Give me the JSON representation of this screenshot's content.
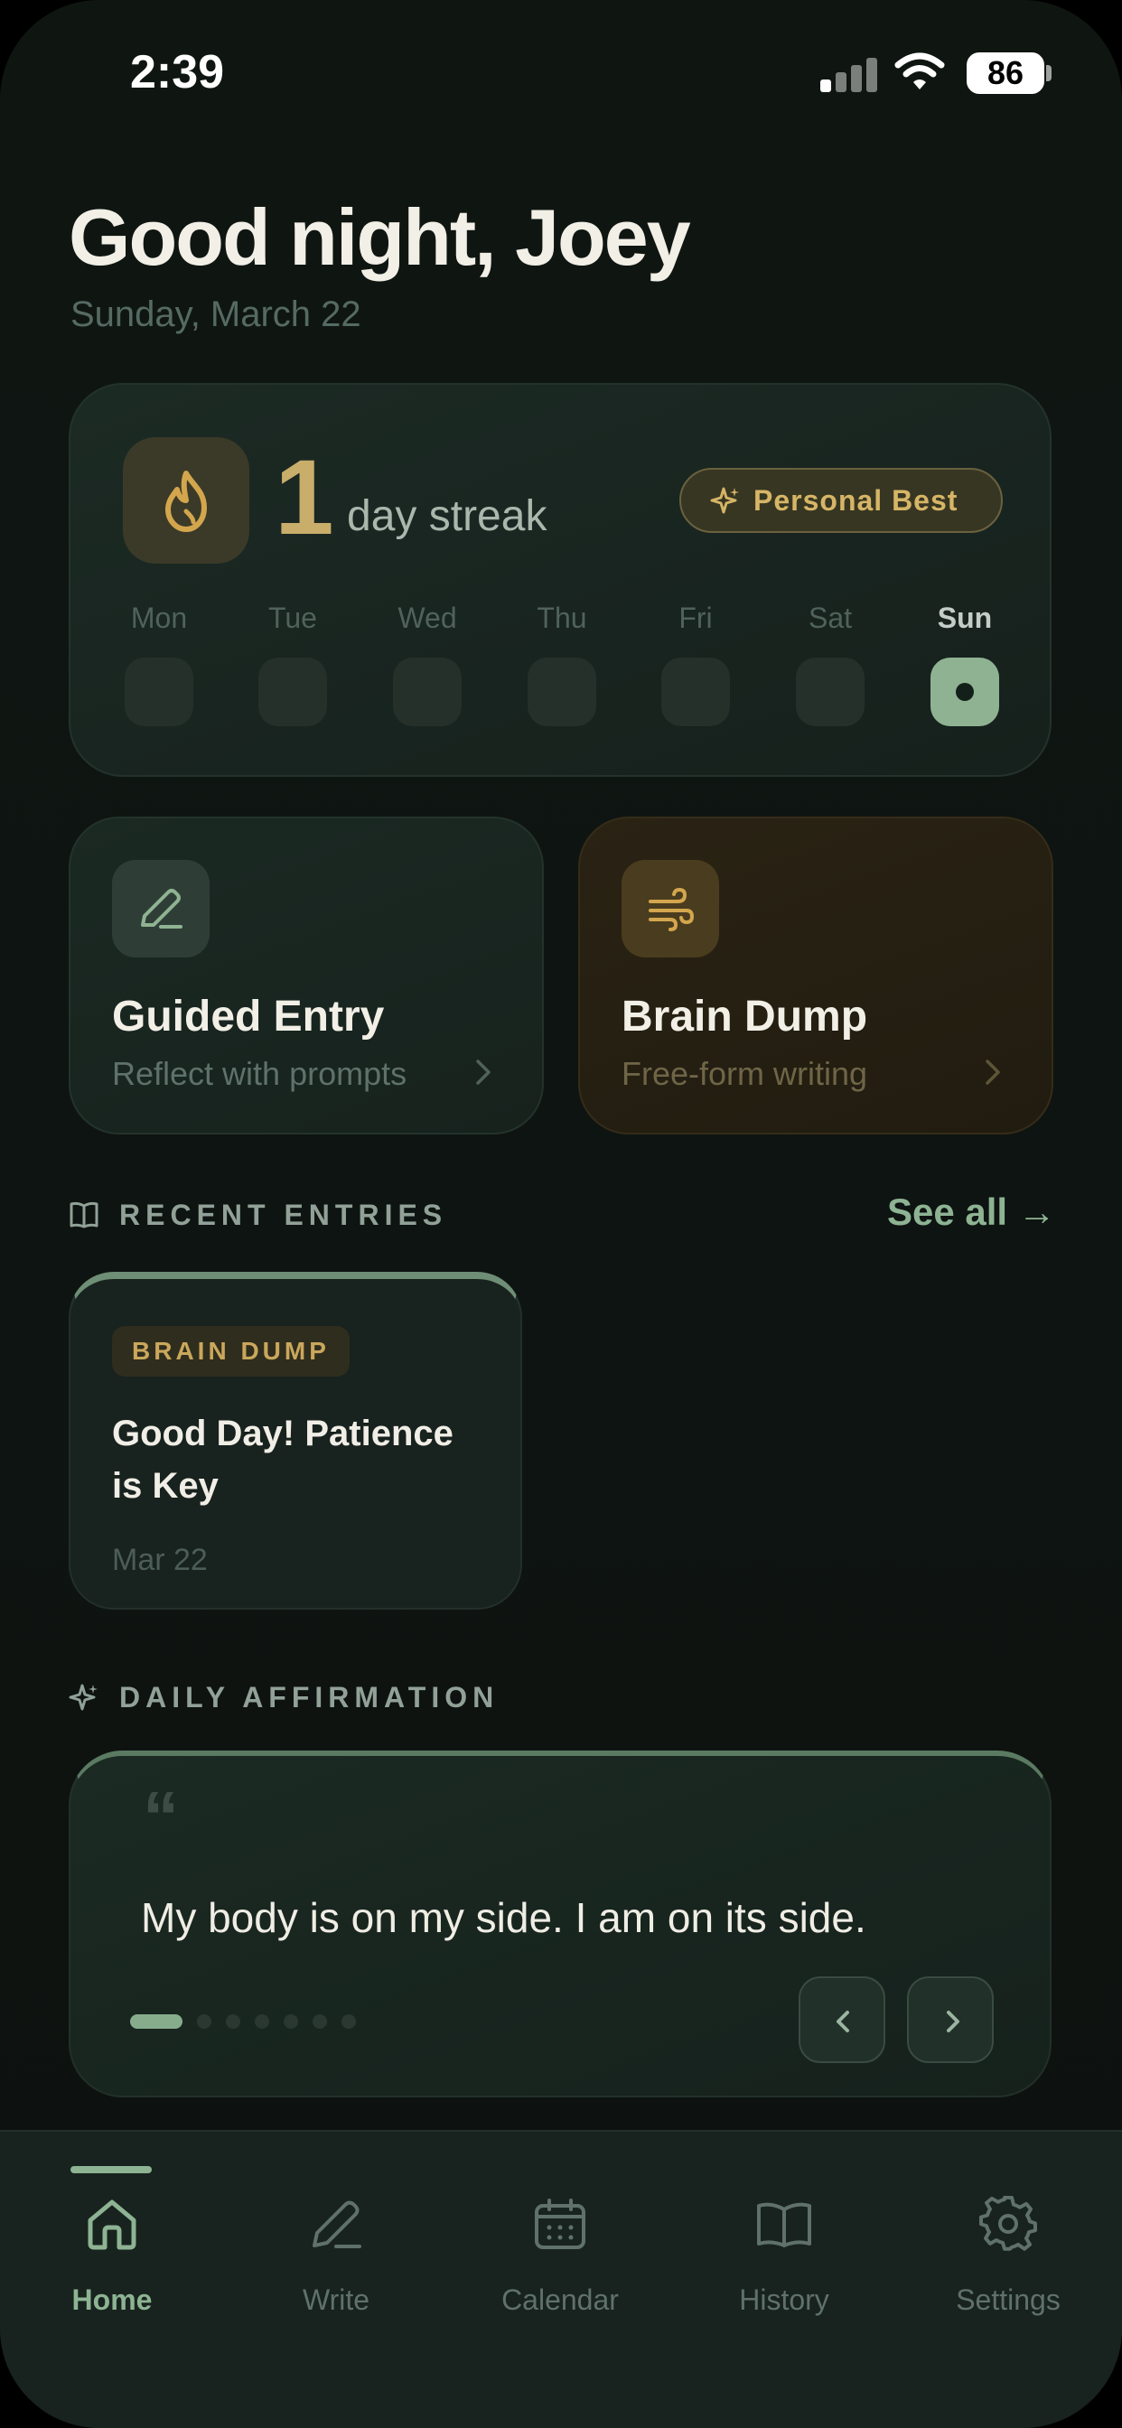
{
  "status_bar": {
    "time": "2:39",
    "battery": "86"
  },
  "header": {
    "greeting": "Good night, Joey",
    "date": "Sunday, March 22"
  },
  "streak": {
    "count": "1",
    "label": "day streak",
    "badge": "Personal Best",
    "days": [
      {
        "label": "Mon",
        "done": false
      },
      {
        "label": "Tue",
        "done": false
      },
      {
        "label": "Wed",
        "done": false
      },
      {
        "label": "Thu",
        "done": false
      },
      {
        "label": "Fri",
        "done": false
      },
      {
        "label": "Sat",
        "done": false
      },
      {
        "label": "Sun",
        "done": true
      }
    ]
  },
  "actions": {
    "guided": {
      "title": "Guided Entry",
      "subtitle": "Reflect with prompts"
    },
    "brain_dump": {
      "title": "Brain Dump",
      "subtitle": "Free-form writing"
    }
  },
  "recent": {
    "heading": "RECENT ENTRIES",
    "see_all": "See all →",
    "entries": [
      {
        "tag": "BRAIN DUMP",
        "title": "Good Day! Patience is Key",
        "date": "Mar 22"
      }
    ]
  },
  "affirmation": {
    "heading": "DAILY AFFIRMATION",
    "text": "My body is on my side. I am on its side.",
    "page_count": 7,
    "current_page": 1
  },
  "tabs": [
    {
      "label": "Home",
      "icon": "home-icon",
      "active": true
    },
    {
      "label": "Write",
      "icon": "pencil-icon",
      "active": false
    },
    {
      "label": "Calendar",
      "icon": "calendar-icon",
      "active": false
    },
    {
      "label": "History",
      "icon": "book-icon",
      "active": false
    },
    {
      "label": "Settings",
      "icon": "gear-icon",
      "active": false
    }
  ],
  "colors": {
    "accent": "#8db393",
    "gold": "#c9ad6b",
    "background": "#0f1612"
  }
}
